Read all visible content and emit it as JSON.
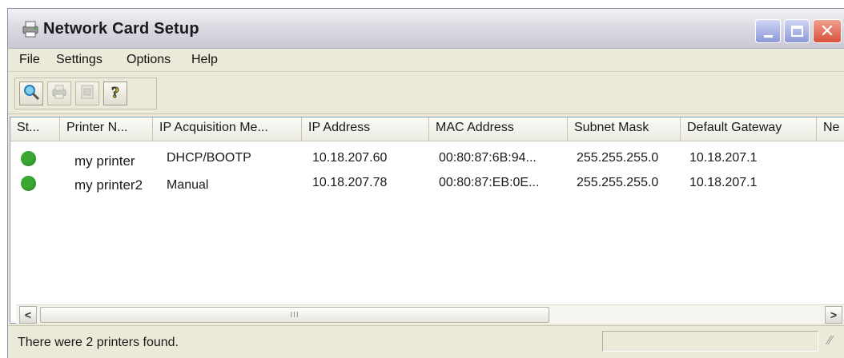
{
  "window": {
    "title": "Network Card Setup"
  },
  "menu": [
    "File",
    "Settings",
    "Options",
    "Help"
  ],
  "toolbar": {
    "buttons": [
      "search-icon",
      "printer-icon",
      "properties-icon",
      "help-icon"
    ]
  },
  "list": {
    "columns": [
      "St...",
      "Printer N...",
      "IP Acquisition Me...",
      "IP Address",
      "MAC Address",
      "Subnet Mask",
      "Default Gateway",
      "Ne"
    ],
    "rows": [
      {
        "status": "online",
        "printer_name": "my printer",
        "ip_acquisition": "DHCP/BOOTP",
        "ip_address": "10.18.207.60",
        "mac": "00:80:87:6B:94...",
        "subnet": "255.255.255.0",
        "gateway": "10.18.207.1"
      },
      {
        "status": "online",
        "printer_name": "my printer2",
        "ip_acquisition": "Manual",
        "ip_address": "10.18.207.78",
        "mac": "00:80:87:EB:0E...",
        "subnet": "255.255.255.0",
        "gateway": "10.18.207.1"
      }
    ]
  },
  "scrollbar": {
    "grip": "III"
  },
  "statusbar": {
    "text": "There were 2 printers found."
  },
  "colors": {
    "status_online": "#3aa832",
    "close_button": "#d8503a",
    "accent": "#8c98d6"
  }
}
